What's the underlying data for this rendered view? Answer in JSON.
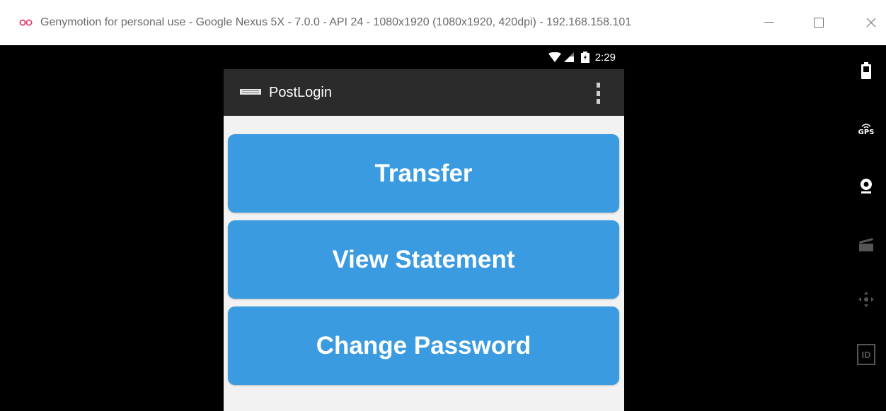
{
  "window": {
    "title": "Genymotion for personal use - Google Nexus 5X - 7.0.0 - API 24 - 1080x1920 (1080x1920, 420dpi) - 192.168.158.101",
    "controls": [
      "minimize-icon",
      "maximize-icon",
      "close-icon"
    ]
  },
  "statusbar": {
    "time": "2:29",
    "icons": [
      "wifi-icon",
      "signal-icon",
      "battery-icon"
    ]
  },
  "appbar": {
    "title": "PostLogin",
    "app_icon": "app-icon",
    "menu_icon": "overflow-menu-icon"
  },
  "buttons": [
    {
      "label": "Transfer"
    },
    {
      "label": "View Statement"
    },
    {
      "label": "Change Password"
    }
  ],
  "sidebar": {
    "tools": [
      "battery-icon",
      "gps-icon",
      "webcam-icon",
      "capture-icon",
      "dpad-icon",
      "id-icon"
    ],
    "gps_label": "GPS",
    "id_label": "ID"
  },
  "colors": {
    "button": "#3b9be0",
    "appbar": "#2b2b2b",
    "content_bg": "#f2f2f2",
    "logo": "#e0426d"
  }
}
